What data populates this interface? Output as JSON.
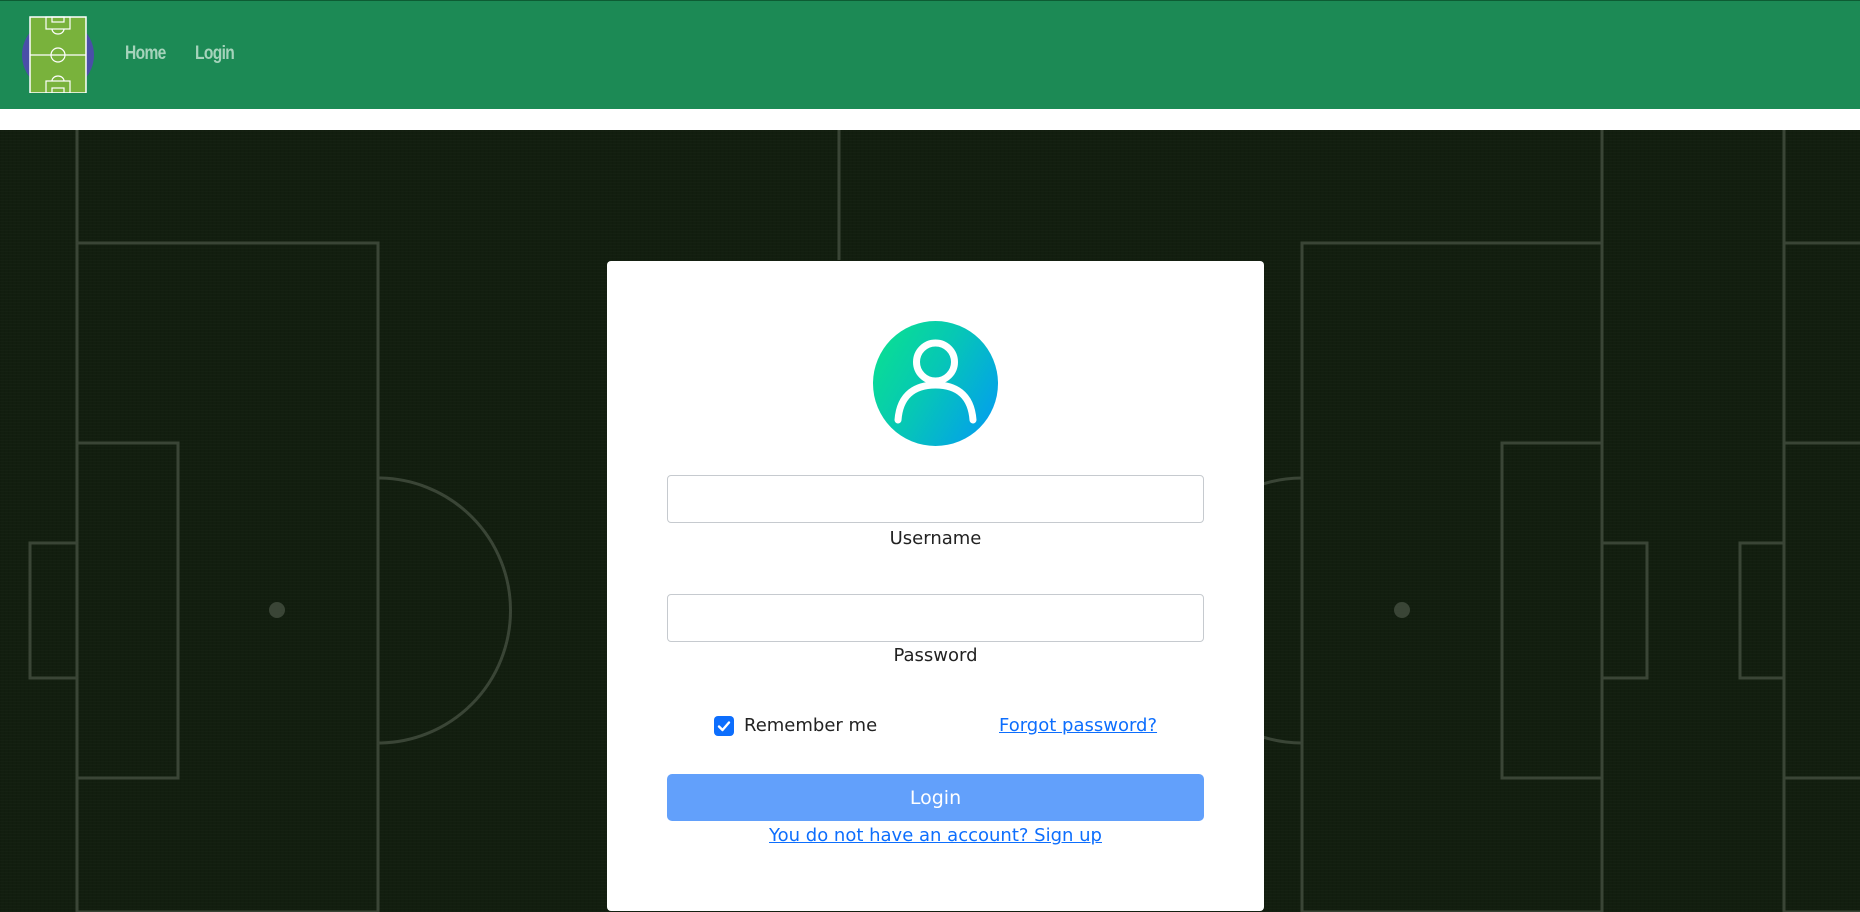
{
  "nav": {
    "logo": "football-pitch-logo",
    "links": [
      "Home",
      "Login"
    ]
  },
  "login_form": {
    "avatar_icon": "user-icon",
    "username": {
      "value": "",
      "label": "Username"
    },
    "password": {
      "value": "",
      "label": "Password"
    },
    "remember_me": {
      "label": "Remember me",
      "checked": true
    },
    "forgot_password": "Forgot password?",
    "submit_label": "Login",
    "signup_link": "You do not have an account? Sign up"
  },
  "colors": {
    "navbar": "#1c8a55",
    "nav_link": "#a5d3bb",
    "background": "#121e0f",
    "button": "#62a0fb",
    "link": "#0d6efd",
    "avatar_gradient": [
      "#0be38c",
      "#0398f7"
    ]
  }
}
